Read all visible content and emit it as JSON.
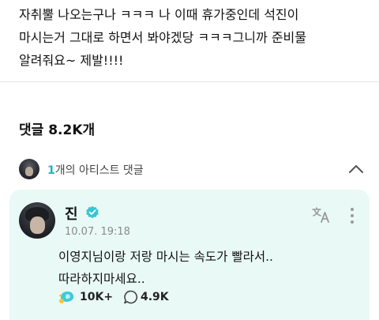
{
  "post": {
    "body": "자취뿔 나오는구나 ㅋㅋㅋ 나 이때 휴가중인데 석진이\n마시는거 그대로 하면서 봐야겠당 ㅋㅋㅋ그니까 준비물\n알려줘요~ 제발!!!!"
  },
  "comments": {
    "title": "댓글 8.2K개",
    "artist_count": "1",
    "artist_label": "개의 아티스트 댓글"
  },
  "artist_comment": {
    "name": "진",
    "date": "10.07. 19:18",
    "text": "이영지님이랑 저랑 마시는 속도가 빨라서..\n따라하지마세요..",
    "likes": "10K+",
    "replies": "4.9K"
  },
  "icons": {
    "collapse": "chevron-up-icon",
    "verified": "verified-badge-icon",
    "translate": "translate-icon",
    "more": "more-vertical-icon",
    "like": "cheer-icon",
    "reply": "comment-bubble-icon"
  },
  "colors": {
    "card_bg": "#e9f9f6",
    "accent": "#19b4c8",
    "verified": "#33c7d4"
  }
}
